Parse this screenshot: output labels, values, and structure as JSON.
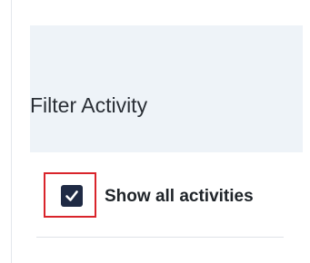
{
  "panel": {
    "title": "Filter Activity"
  },
  "filter": {
    "show_all_label": "Show all activities",
    "show_all_checked": true
  },
  "colors": {
    "header_bg": "#eef3f8",
    "checkbox_fill": "#1f2a44",
    "highlight_border": "#d9242b"
  },
  "icons": {
    "checkbox": "checkmark-icon"
  }
}
